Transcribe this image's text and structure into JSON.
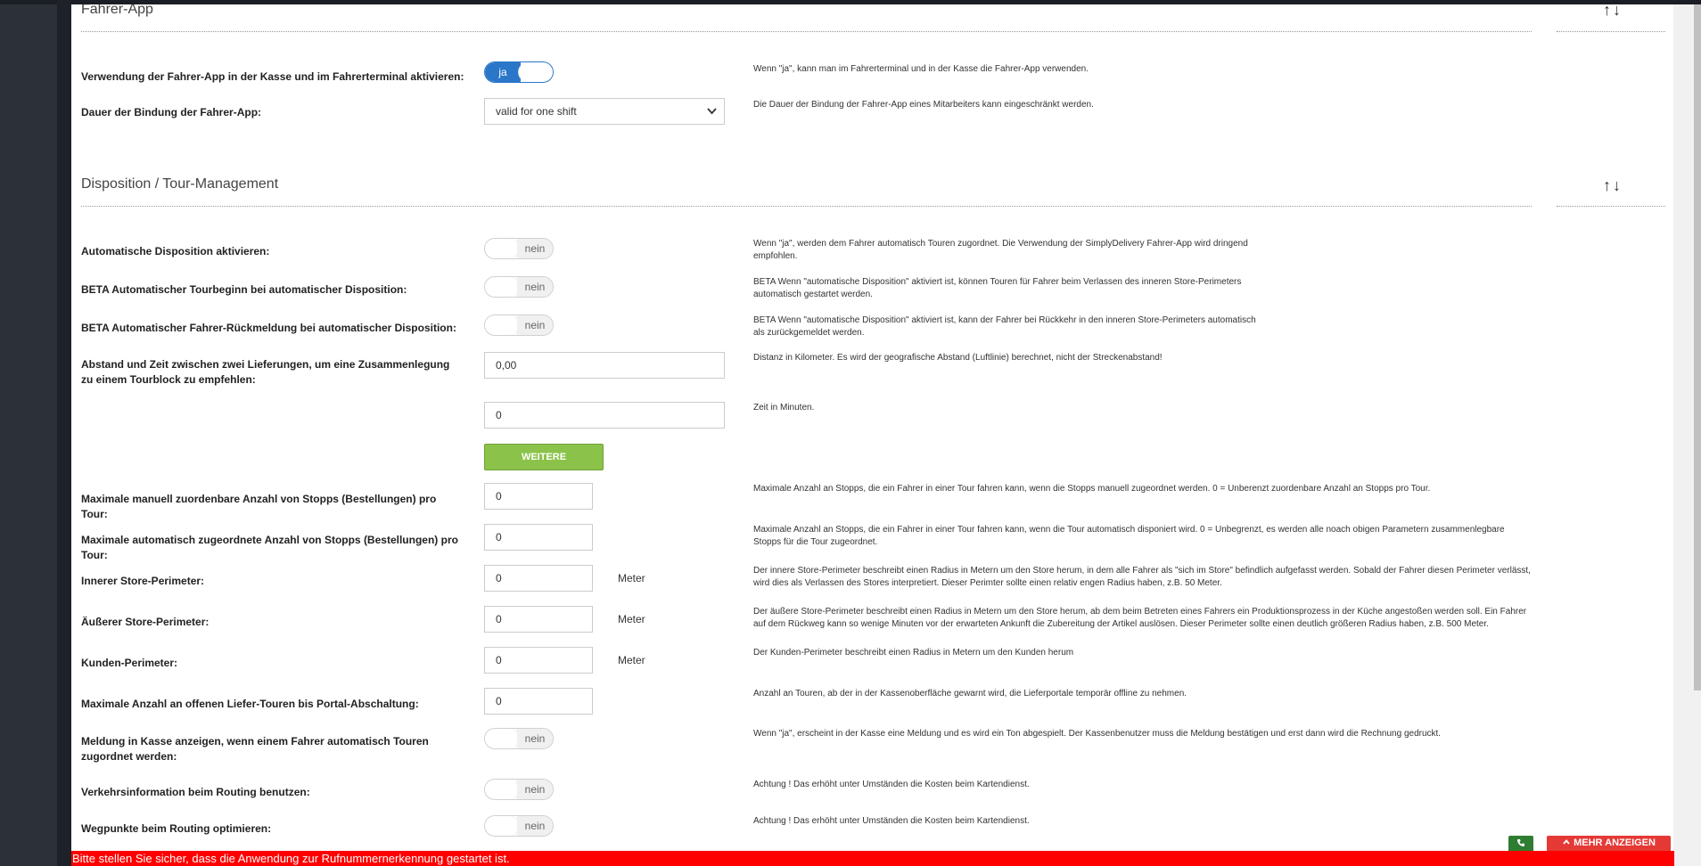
{
  "sections": {
    "fahrer_app": {
      "title": "Fahrer-App",
      "sort": "↑↓"
    },
    "dispo": {
      "title": "Disposition / Tour-Management",
      "sort": "↑↓"
    }
  },
  "fahrer_app": {
    "use_app": {
      "label": "Verwendung der Fahrer-App in der Kasse und im Fahrerterminal aktivieren:",
      "toggle": "ja",
      "help": "Wenn \"ja\", kann man im Fahrerterminal und in der Kasse die Fahrer-App verwenden."
    },
    "binding": {
      "label": "Dauer der Bindung der Fahrer-App:",
      "value": "valid for one shift",
      "help": "Die Dauer der Bindung der Fahrer-App eines Mitarbeiters kann eingeschränkt werden."
    }
  },
  "dispo": {
    "auto_dispo": {
      "label": "Automatische Disposition aktivieren:",
      "toggle": "nein",
      "help": "Wenn \"ja\", werden dem Fahrer automatisch Touren zugordnet. Die Verwendung der SimplyDelivery Fahrer-App wird dringend empfohlen."
    },
    "auto_tour_start": {
      "label": "BETA Automatischer Tourbeginn bei automatischer Disposition:",
      "toggle": "nein",
      "help": "BETA Wenn \"automatische Disposition\" aktiviert ist, können Touren für Fahrer beim Verlassen des inneren Store-Perimeters automatisch gestartet werden."
    },
    "auto_return": {
      "label": "BETA Automatischer Fahrer-Rückmeldung bei automatischer Disposition:",
      "toggle": "nein",
      "help": "BETA Wenn \"automatische Disposition\" aktiviert ist, kann der Fahrer bei Rückkehr in den inneren Store-Perimeters automatisch als zurückgemeldet werden."
    },
    "distance_time": {
      "label": "Abstand und Zeit zwischen zwei Lieferungen, um eine Zusammenlegung zu einem Tourblock zu empfehlen:",
      "distance_value": "0,00",
      "distance_help": "Distanz in Kilometer. Es wird der geografische Abstand (Luftlinie) berechnet, nicht der Streckenabstand!",
      "time_value": "0",
      "time_help": "Zeit in Minuten."
    },
    "more_info_button": "WEITERE INFORMATIONEN",
    "max_manual": {
      "label": "Maximale manuell zuordenbare Anzahl von Stopps (Bestellungen) pro Tour:",
      "value": "0",
      "help": "Maximale Anzahl an Stopps, die ein Fahrer in einer Tour fahren kann, wenn die Stopps manuell zugeordnet werden. 0 = Unberenzt zuordenbare Anzahl an Stopps pro Tour."
    },
    "max_auto": {
      "label": "Maximale automatisch zugeordnete Anzahl von Stopps (Bestellungen) pro Tour:",
      "value": "0",
      "help": "Maximale Anzahl an Stopps, die ein Fahrer in einer Tour fahren kann, wenn die Tour automatisch disponiert wird. 0 = Unbegrenzt, es werden alle noach obigen Parametern zusammenlegbare Stopps für die Tour zugeordnet."
    },
    "inner_perimeter": {
      "label": "Innerer Store-Perimeter:",
      "value": "0",
      "unit": "Meter",
      "help": "Der innere Store-Perimeter beschreibt einen Radius in Metern um den Store herum, in dem alle Fahrer als \"sich im Store\" befindlich aufgefasst werden. Sobald der Fahrer diesen Perimeter verlässt, wird dies als Verlassen des Stores interpretiert. Dieser Perimter sollte einen relativ engen Radius haben, z.B. 50 Meter."
    },
    "outer_perimeter": {
      "label": "Äußerer Store-Perimeter:",
      "value": "0",
      "unit": "Meter",
      "help": "Der äußere Store-Perimeter beschreibt einen Radius in Metern um den Store herum, ab dem beim Betreten eines Fahrers ein Produktionsprozess in der Küche angestoßen werden soll. Ein Fahrer auf dem Rückweg kann so wenige Minuten vor der erwarteten Ankunft die Zubereitung der Artikel auslösen. Dieser Perimeter sollte einen deutlich größeren Radius haben, z.B. 500 Meter."
    },
    "customer_perimeter": {
      "label": "Kunden-Perimeter:",
      "value": "0",
      "unit": "Meter",
      "help": "Der Kunden-Perimeter beschreibt einen Radius in Metern um den Kunden herum"
    },
    "max_open_tours": {
      "label": "Maximale Anzahl an offenen Liefer-Touren bis Portal-Abschaltung:",
      "value": "0",
      "help": "Anzahl an Touren, ab der in der Kassenoberfläche gewarnt wird, die Lieferportale temporär offline zu nehmen."
    },
    "notify_kasse": {
      "label": "Meldung in Kasse anzeigen, wenn einem Fahrer automatisch Touren zugordnet werden:",
      "toggle": "nein",
      "help": "Wenn \"ja\", erscheint in der Kasse eine Meldung und es wird ein Ton abgespielt. Der Kassenbenutzer muss die Meldung bestätigen und erst dann wird die Rechnung gedruckt."
    },
    "traffic": {
      "label": "Verkehrsinformation beim Routing benutzen:",
      "toggle": "nein",
      "help": "Achtung ! Das erhöht unter Umständen die Kosten beim Kartendienst."
    },
    "waypoints": {
      "label": "Wegpunkte beim Routing optimieren:",
      "toggle": "nein",
      "help": "Achtung ! Das erhöht unter Umständen die Kosten beim Kartendienst."
    }
  },
  "footer": {
    "alert": "Bitte stellen Sie sicher, dass die Anwendung zur Rufnummernerkennung gestartet ist.",
    "more_button": "MEHR ANZEIGEN",
    "more_icon": "chevron-up-icon",
    "phone_icon": "phone-icon"
  },
  "colors": {
    "toggle_on": "#2a77c9",
    "info_button": "#8bc34a",
    "alert": "#ff0000",
    "more_button": "#e53935",
    "phone_button": "#2e7d32"
  }
}
